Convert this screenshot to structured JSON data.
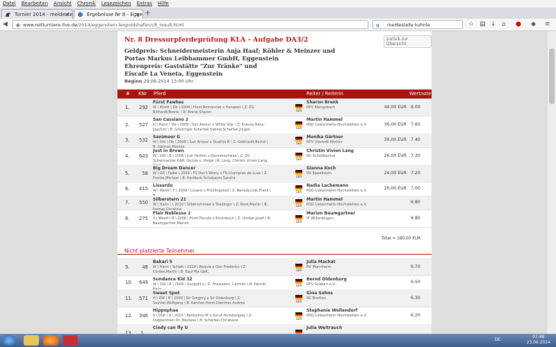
{
  "menu": [
    "Datei",
    "Bearbeiten",
    "Ansicht",
    "Chronik",
    "Lesezeichen",
    "Extras",
    "Hilfe"
  ],
  "tabs": [
    {
      "label": "Turnier 2014 - meldestelle-...",
      "close": "×"
    },
    {
      "label": "Ergebnisse Nr 8 - Eggenstei...",
      "close": "×"
    }
  ],
  "newtab": "+",
  "url": {
    "domain": "www.reitturniere-live.de",
    "path": "/2014/eggenstein-leopoldshafen/c8_result.html"
  },
  "search": {
    "value": "meldestelle kuhnle"
  },
  "page": {
    "title": "Nr. 8 Dressurpferdeprüfung KLA - Aufgabe DA3/2",
    "back": "zurück zur Übersicht",
    "prize_lines": [
      "Geldpreis: Schneidermeisterin Anja Haaf; Köhler & Meinzer und",
      "Portas Markus Leibhammer GmbH, Eggenstein",
      "Ehrenpreis: Gaststätte \"Zur Tränke\" und",
      "Eiscafé La Veneta, Eggenstein"
    ],
    "beginn_label": "Beginn",
    "beginn_value": "29.06.2014 13:00 Uhr",
    "columns": {
      "no": "#",
      "knr": "KNr",
      "horse": "Pferd",
      "rider": "Reiter / Reiterin",
      "score": "Wertnote"
    },
    "rows": [
      {
        "no": "1.",
        "knr": "292",
        "horse": "Fürst Fawkes",
        "desc": "W \\ Württ \\ Db \\ 2009 \\ Fürst Romancier x Hanwest \\ Z: ZG Billhardt/Brenk, \\ B: Brenk,Sharon",
        "nat": "GER",
        "rider": "Sharon Brenk",
        "club": "RFV Königsbach",
        "prize": "44,00 EUR",
        "score": "8.00"
      },
      {
        "no": "2.",
        "knr": "527",
        "horse": "San Cassiano 2",
        "desc": "H \\ Hann \\ Db \\ 2009 \\ San Amour x White Star \\ Z: Krause,Hans-Joachim \\ B: Greisinger-Scherbel,Sabine;Scherbel,Jürgen",
        "nat": "GER",
        "rider": "Martin Hammel",
        "club": "RSG Linkenheim-Hochstetten e.V.",
        "prize": "36,00 EUR",
        "score": "7.60"
      },
      {
        "no": "3.",
        "knr": "532",
        "horse": "Sanimoor G",
        "desc": "W \\ Old \\ Db \\ 2009 \\ San Amour x Quattro B \\ Z: Gebhardt,Bernd \\ B: Gärtner,Monika",
        "nat": "GER",
        "rider": "Monika Gärtner",
        "club": "RFV Ubstadt-Weiher",
        "prize": "30,00 EUR",
        "score": "7.40"
      },
      {
        "no": "4.",
        "knr": "643",
        "horse": "Just in Brown",
        "desc": "W \\ Old \\ B \\ 2008 \\ Just Perfect x Donnerschwee \\ Z: ZG Schermacher GbR, Gunda u. Helge \\ B: Lang, Christin Vivien;Lang, Jenny",
        "nat": "GER",
        "rider": "Christin Vivien Lang",
        "club": "RC Schöllbacher",
        "prize": "26,00 EUR",
        "score": "7.30"
      },
      {
        "no": "5.",
        "knr": "58",
        "horse": "Big Dream Dancer",
        "desc": "W \\ DR \\ Falbe \\ 2009 \\ FS Don't Worry x FS Champion de Luxe \\ Z: Franke,Michael \\ B: Hardieck-Schebaum,Sandra",
        "nat": "GER",
        "rider": "Gianna Koch",
        "club": "RV Eppelheim",
        "prize": "24,00 EUR",
        "score": "7.20"
      },
      {
        "no": "6.",
        "knr": "415",
        "horse": "Lissardo",
        "desc": "W \\ Westf \\ F \\ 2009 \\ Lissaro x Frühlingsball \\ Z: Benedyczak,Frank \\ B:",
        "nat": "GER",
        "rider": "Nadia Lachemann",
        "club": "RSG Linkenheim-Hochstetten e.V.",
        "prize": "20,00 EUR",
        "score": "7.00"
      },
      {
        "no": "7.",
        "knr": "550",
        "horse": "Silberstern 21",
        "desc": "W \\ Hann \\ \\ 2010 \\ Silberschmied x Stedinger \\ Z: Nork,Martin \\ B: Freitag,Christina",
        "nat": "GER",
        "rider": "Martin Hammel",
        "club": "RSG Linkenheim-Hochstetten e.V.",
        "prize": "",
        "score": "6.80"
      },
      {
        "no": "8.",
        "knr": "275",
        "horse": "Flair Noblesse 2",
        "desc": "S \\ Westf \\ B \\ 2008 \\ Fürst Piccolo x Ehrenbuch \\ Z: Ulmker,Josef \\ B: Baumgartner,Marion",
        "nat": "GER",
        "rider": "Marion Baumgartner",
        "club": "IF Wilferdingen",
        "prize": "",
        "score": "6.80"
      }
    ],
    "total": "Total = 180,00 EUR",
    "not_placed_label": "Nicht platzierte Teilnehmer",
    "not_placed": [
      {
        "no": "9.",
        "knr": "48",
        "horse": "Bakari 5",
        "desc": "W \\ Hann \\ Schwb \\ 2010 \\ Bequia x Don Frederico \\ Z: Cordes,Martin \\ B: Equi-Ma GbR,",
        "nat": "GER",
        "rider": "Julia Machat",
        "club": "RV Mannheim",
        "prize": "",
        "score": "6.70"
      },
      {
        "no": "10.",
        "knr": "649",
        "horse": "Sundance Kid 32",
        "desc": "W \\ Old \\ B \\ 2009 \\ Sungold x \\ Z: Friesleben, Carmen \\ B: Herndl, Nelly",
        "nat": "GER",
        "rider": "Bernd Oldenburg",
        "club": "RFV Graben e.V.",
        "prize": "",
        "score": "6.50"
      },
      {
        "no": "11.",
        "knr": "571",
        "horse": "Sweet Spot",
        "desc": "H \\ ZW \\ B \\ 2009 \\ Sir Gregory x Sir Oldenburg \\ Z: Sautter,Wolfgang \\ B: Karcher,Horst;Dammer,Andrea",
        "nat": "GER",
        "rider": "Gina Sohns",
        "club": "RC Bretten",
        "prize": "",
        "score": "6.30"
      },
      {
        "no": "12.",
        "knr": "346",
        "horse": "Hippophae",
        "desc": "S \\ DSP \\ b \\ 2010 \\ Bellissimo M x Garut Humburgsky \\ Z: Dobberthien Dr.,Marliese \\ B: Scherbel,Christiane",
        "nat": "GER",
        "rider": "Stephanie Wollendorf",
        "club": "RSG Linkenheim-Hochstetten e.V.",
        "prize": "",
        "score": "6.20"
      },
      {
        "no": "13.",
        "knr": "1...",
        "horse": "Cindy can fly U",
        "desc": "",
        "nat": "GER",
        "rider": "Julia Weitrauch",
        "club": "",
        "prize": "",
        "score": ""
      }
    ]
  },
  "taskbar": {
    "lang": "DE",
    "time": "07:46",
    "date": "23.06.2014"
  }
}
